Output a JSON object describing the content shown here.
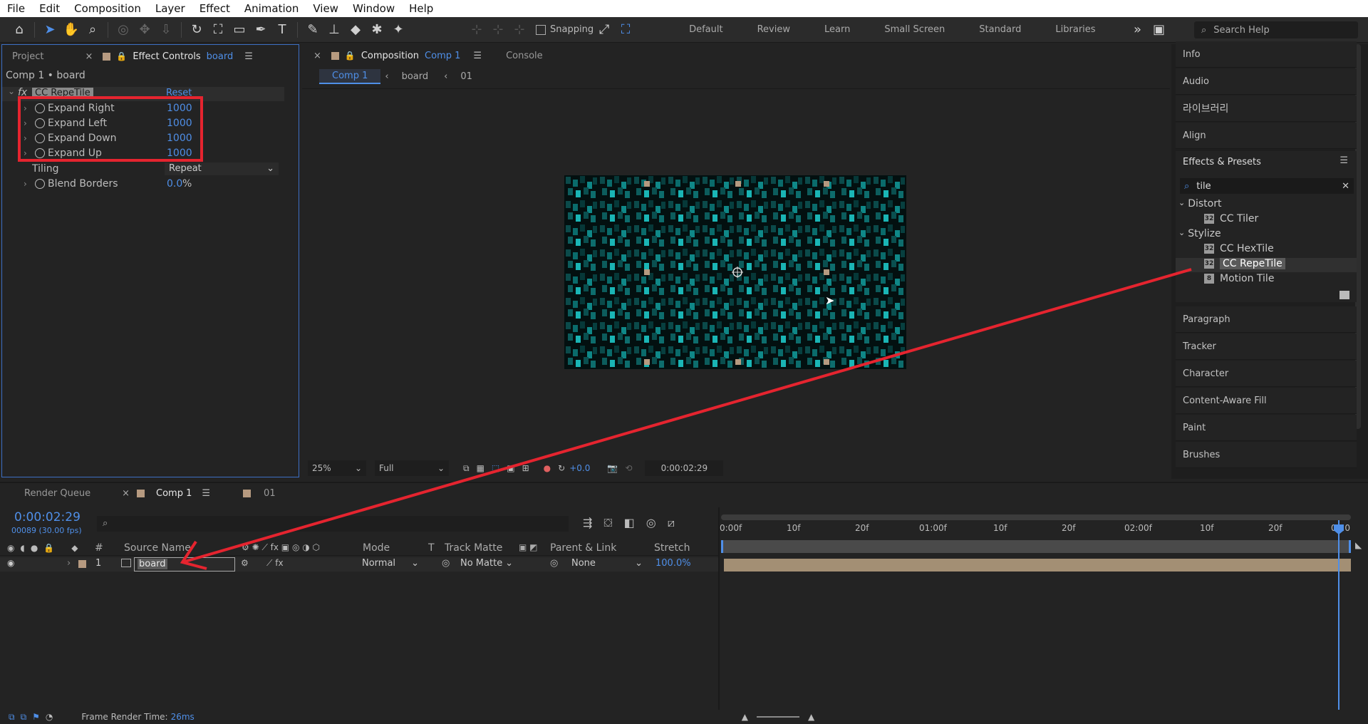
{
  "menu": [
    "File",
    "Edit",
    "Composition",
    "Layer",
    "Effect",
    "Animation",
    "View",
    "Window",
    "Help"
  ],
  "toolbar": {
    "snapping_label": "Snapping",
    "workspaces": [
      "Default",
      "Review",
      "Learn",
      "Small Screen",
      "Standard",
      "Libraries"
    ],
    "search_help": "Search Help"
  },
  "left_panel": {
    "tabs": {
      "project": "Project",
      "effect_controls": "Effect Controls",
      "effect_controls_target": "board"
    },
    "breadcrumb": "Comp 1 • board",
    "effect_name": "CC RepeTile",
    "reset_label": "Reset",
    "properties": [
      {
        "label": "Expand Right",
        "value": "1000"
      },
      {
        "label": "Expand Left",
        "value": "1000"
      },
      {
        "label": "Expand Down",
        "value": "1000"
      },
      {
        "label": "Expand Up",
        "value": "1000"
      }
    ],
    "tiling": {
      "label": "Tiling",
      "value": "Repeat"
    },
    "blend": {
      "label": "Blend Borders",
      "value": "0.0",
      "unit": "%"
    }
  },
  "comp_panel": {
    "tab_label": "Composition",
    "tab_comp": "Comp 1",
    "console_tab": "Console",
    "crumbs": [
      "Comp 1",
      "board",
      "01"
    ],
    "zoom": "25%",
    "resolution": "Full",
    "exposure": "+0.0",
    "timecode": "0:00:02:29"
  },
  "right_panel": {
    "items_top": [
      "Info",
      "Audio",
      "라이브러리",
      "Align"
    ],
    "effects_title": "Effects & Presets",
    "search_value": "tile",
    "groups": [
      {
        "name": "Distort",
        "items": [
          "CC Tiler"
        ]
      },
      {
        "name": "Stylize",
        "items": [
          "CC HexTile",
          "CC RepeTile",
          "Motion Tile"
        ]
      }
    ],
    "items_bottom": [
      "Paragraph",
      "Tracker",
      "Character",
      "Content-Aware Fill",
      "Paint",
      "Brushes"
    ]
  },
  "timeline": {
    "tabs": {
      "render_queue": "Render Queue",
      "comp": "Comp 1",
      "other": "01"
    },
    "timecode": "0:00:02:29",
    "frame_info": "00089 (30.00 fps)",
    "headers": {
      "num": "#",
      "source_name": "Source Name",
      "mode": "Mode",
      "t": "T",
      "track_matte": "Track Matte",
      "parent": "Parent & Link",
      "stretch": "Stretch"
    },
    "layer": {
      "index": "1",
      "name": "board",
      "mode": "Normal",
      "track_matte": "No Matte",
      "parent": "None",
      "stretch": "100.0%"
    },
    "ruler": [
      "0:00f",
      "10f",
      "20f",
      "01:00f",
      "10f",
      "20f",
      "02:00f",
      "10f",
      "20f",
      "03:0"
    ],
    "footer_label": "Frame Render Time:",
    "footer_value": "26ms"
  },
  "colors": {
    "accent": "#4f8fe8",
    "annotation": "#e5242f",
    "layer_bar": "#a38f74"
  }
}
